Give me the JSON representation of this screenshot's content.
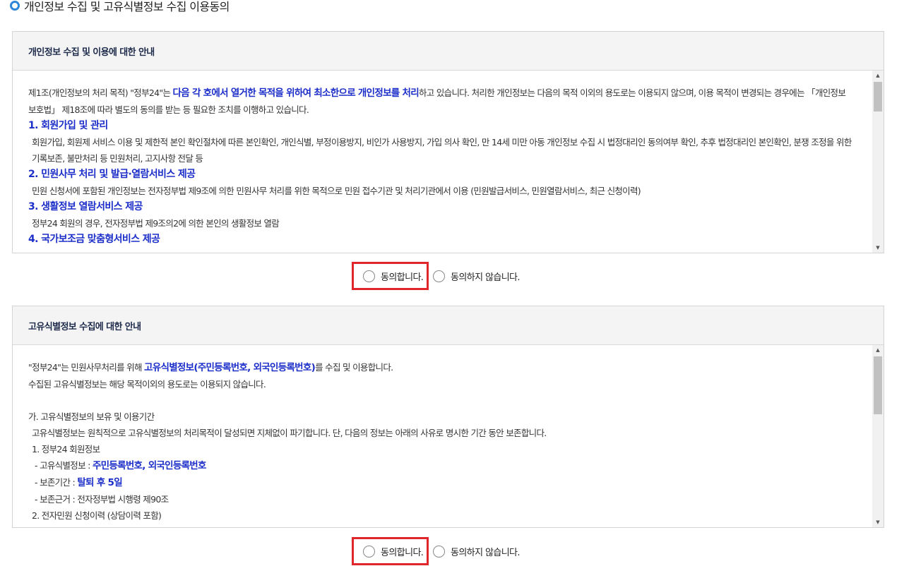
{
  "page": {
    "heading": "개인정보 수집 및 고유식별정보 수집 이용동의"
  },
  "privacy": {
    "title": "개인정보 수집 및 이용에 대한 안내",
    "intro_pre": "제1조(개인정보의 처리 목적) \"정부24\"는 ",
    "intro_hl": "다음 각 호에서 열거한 목적을 위하여 최소한으로 개인정보를 처리",
    "intro_post": "하고 있습니다. 처리한 개인정보는 다음의 목적 이외의 용도로는 이용되지 않으며, 이용 목적이 변경되는 경우에는 「개인정보 보호법」 제18조에 따라 별도의 동의를 받는 등 필요한 조치를 이행하고 있습니다.",
    "sections": [
      {
        "title": "1. 회원가입 및 관리",
        "body": "회원가입, 회원제 서비스 이용 및 제한적 본인 확인절차에 따른 본인확인, 개인식별, 부정이용방지, 비인가 사용방지, 가입 의사 확인, 만 14세 미만 아동 개인정보 수집 시 법정대리인 동의여부 확인, 추후 법정대리인 본인확인, 분쟁 조정을 위한 기록보존, 불만처리 등 민원처리, 고지사항 전달 등"
      },
      {
        "title": "2. 민원사무 처리 및 발급·열람서비스 제공",
        "body": "민원 신청서에 포함된 개인정보는 전자정부법 제9조에 의한 민원사무 처리를 위한 목적으로 민원 접수기관 및 처리기관에서 이용 (민원발급서비스, 민원열람서비스, 최근 신청이력)"
      },
      {
        "title": "3. 생활정보 열람서비스 제공",
        "body": "정부24 회원의 경우, 전자정부법 제9조의2에 의한 본인의 생활정보 열람"
      },
      {
        "title": "4. 국가보조금 맞춤형서비스 제공",
        "body": ""
      }
    ],
    "agree_label": "동의합니다.",
    "disagree_label": "동의하지 않습니다."
  },
  "unique_id": {
    "title": "고유식별정보 수집에 대한 안내",
    "line1_pre": "\"정부24\"는 민원사무처리를 위해 ",
    "line1_hl": "고유식별정보(주민등록번호, 외국인등록번호)",
    "line1_post": "를 수집 및 이용합니다.",
    "line2": "수집된 고유식별정보는 해당 목적이외의 용도로는 이용되지 않습니다.",
    "retention_title": "가. 고유식별정보의 보유 및 이용기간",
    "retention_body": "고유식별정보는 원칙적으로 고유식별정보의 처리목적이 달성되면 지체없이 파기합니다. 단, 다음의 정보는 아래의 사유로 명시한 기간 동안 보존합니다.",
    "item1": "1. 정부24 회원정보",
    "item1_a_label": "- 고유식별정보 : ",
    "item1_a_value": "주민등록번호, 외국인등록번호",
    "item1_b_label": "- 보존기간 : ",
    "item1_b_value": "탈퇴 후 5일",
    "item1_c": "- 보존근거 : 전자정부법 시행령 제90조",
    "item2": "2. 전자민원 신청이력 (상담이력 포함)",
    "agree_label": "동의합니다.",
    "disagree_label": "동의하지 않습니다."
  },
  "colors": {
    "highlight": "#1c2ec9",
    "agree_border": "#e0262b",
    "heading_bullet": "#2f86d8"
  }
}
